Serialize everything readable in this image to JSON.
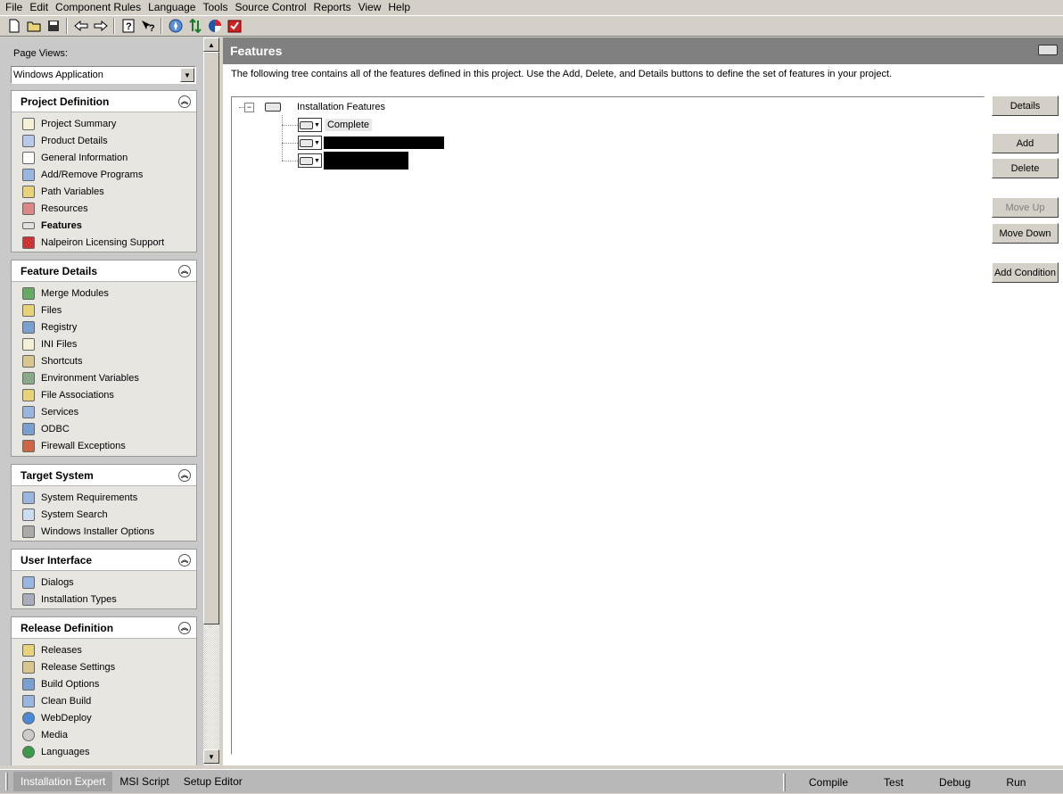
{
  "menubar": [
    "File",
    "Edit",
    "Component Rules",
    "Language",
    "Tools",
    "Source Control",
    "Reports",
    "View",
    "Help"
  ],
  "toolbar_icons": [
    "new-file-icon",
    "open-folder-icon",
    "save-icon",
    "back-arrow-icon",
    "forward-arrow-icon",
    "help-icon",
    "context-help-icon",
    "compass-icon",
    "sort-arrows-icon",
    "palette-icon",
    "shield-check-icon"
  ],
  "left": {
    "page_views_label": "Page Views:",
    "page_views_value": "Windows Application",
    "groups": [
      {
        "title": "Project Definition",
        "items": [
          {
            "label": "Project Summary",
            "icon": "clipboard-icon",
            "active": false
          },
          {
            "label": "Product Details",
            "icon": "package-icon",
            "active": false
          },
          {
            "label": "General Information",
            "icon": "document-icon",
            "active": false
          },
          {
            "label": "Add/Remove Programs",
            "icon": "programs-icon",
            "active": false
          },
          {
            "label": "Path Variables",
            "icon": "path-icon",
            "active": false
          },
          {
            "label": "Resources",
            "icon": "resources-icon",
            "active": false
          },
          {
            "label": "Features",
            "icon": "drive-icon",
            "active": true
          },
          {
            "label": "Nalpeiron Licensing Support",
            "icon": "shield-icon",
            "active": false
          }
        ]
      },
      {
        "title": "Feature Details",
        "items": [
          {
            "label": "Merge Modules",
            "icon": "puzzle-icon",
            "active": false
          },
          {
            "label": "Files",
            "icon": "folder-icon",
            "active": false
          },
          {
            "label": "Registry",
            "icon": "registry-icon",
            "active": false
          },
          {
            "label": "INI Files",
            "icon": "ini-file-icon",
            "active": false
          },
          {
            "label": "Shortcuts",
            "icon": "shortcut-icon",
            "active": false
          },
          {
            "label": "Environment Variables",
            "icon": "environment-icon",
            "active": false
          },
          {
            "label": "File Associations",
            "icon": "association-icon",
            "active": false
          },
          {
            "label": "Services",
            "icon": "services-icon",
            "active": false
          },
          {
            "label": "ODBC",
            "icon": "database-icon",
            "active": false
          },
          {
            "label": "Firewall Exceptions",
            "icon": "firewall-icon",
            "active": false
          }
        ]
      },
      {
        "title": "Target System",
        "items": [
          {
            "label": "System Requirements",
            "icon": "computer-icon",
            "active": false
          },
          {
            "label": "System Search",
            "icon": "search-icon",
            "active": false
          },
          {
            "label": "Windows Installer Options",
            "icon": "installer-icon",
            "active": false
          }
        ]
      },
      {
        "title": "User Interface",
        "items": [
          {
            "label": "Dialogs",
            "icon": "dialog-icon",
            "active": false
          },
          {
            "label": "Installation Types",
            "icon": "types-icon",
            "active": false
          }
        ]
      },
      {
        "title": "Release Definition",
        "items": [
          {
            "label": "Releases",
            "icon": "release-icon",
            "active": false
          },
          {
            "label": "Release Settings",
            "icon": "settings-icon",
            "active": false
          },
          {
            "label": "Build Options",
            "icon": "build-icon",
            "active": false
          },
          {
            "label": "Clean Build",
            "icon": "clean-build-icon",
            "active": false
          },
          {
            "label": "WebDeploy",
            "icon": "globe-icon",
            "active": false
          },
          {
            "label": "Media",
            "icon": "media-icon",
            "active": false
          },
          {
            "label": "Languages",
            "icon": "languages-icon",
            "active": false
          }
        ]
      }
    ]
  },
  "right": {
    "title": "Features",
    "description": "The following tree contains all of the features defined in this project. Use the Add, Delete, and Details buttons to define the set of features in your project.",
    "tree": {
      "root": "Installation Features",
      "children": [
        "Complete",
        "",
        ""
      ]
    },
    "buttons": {
      "details": "Details",
      "add": "Add",
      "delete": "Delete",
      "move_up": "Move Up",
      "move_down": "Move Down",
      "add_condition": "Add Condition"
    }
  },
  "status": {
    "tabs": [
      "Installation Expert",
      "MSI Script",
      "Setup Editor"
    ],
    "actions": [
      "Compile",
      "Test",
      "Debug",
      "Run"
    ]
  }
}
